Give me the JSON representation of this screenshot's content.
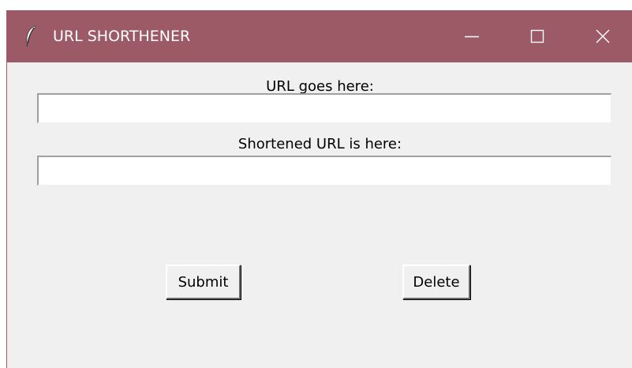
{
  "window": {
    "title": "URL SHORTHENER",
    "app_icon": "feather-icon",
    "titlebar_color": "#9c5a66",
    "background_color": "#f0f0f0",
    "controls": {
      "minimize_icon": "minimize-icon",
      "maximize_icon": "maximize-icon",
      "close_icon": "close-icon"
    }
  },
  "form": {
    "url_label": "URL goes here:",
    "url_value": "",
    "short_label": "Shortened URL is here:",
    "short_value": ""
  },
  "buttons": {
    "submit_label": "Submit",
    "delete_label": "Delete"
  }
}
